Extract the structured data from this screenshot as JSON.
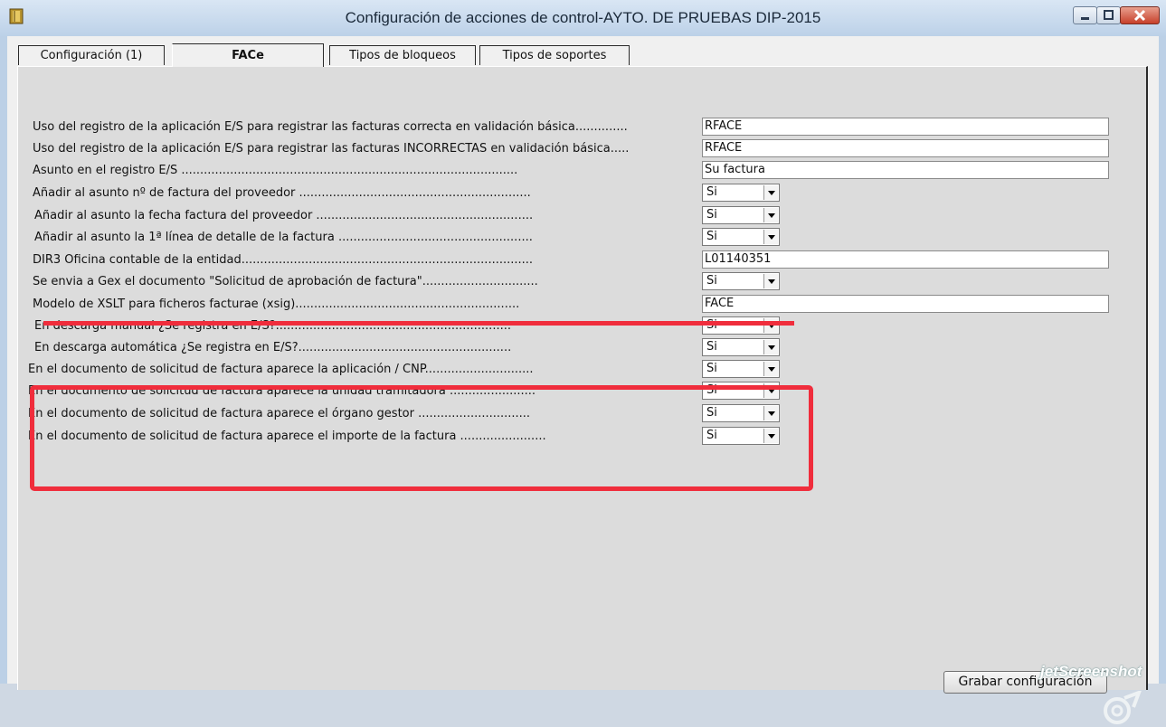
{
  "window": {
    "title": "Configuración de acciones de control-AYTO. DE PRUEBAS DIP-2015",
    "controls": [
      "minimize",
      "maximize",
      "close"
    ]
  },
  "tabs": [
    {
      "label": "Configuración (1)",
      "active": false
    },
    {
      "label": "FACe",
      "active": true
    },
    {
      "label": "Tipos de bloqueos",
      "active": false
    },
    {
      "label": "Tipos de soportes",
      "active": false
    }
  ],
  "settings": [
    {
      "label": "Uso del registro de la aplicación E/S para registrar las facturas correcta en validación básica..............",
      "kind": "text",
      "value": "RFACE"
    },
    {
      "label": "Uso del registro de la aplicación E/S para registrar las facturas INCORRECTAS en validación básica.....",
      "kind": "text",
      "value": "RFACE"
    },
    {
      "label": "Asunto en el registro E/S ..........................................................................................",
      "kind": "text",
      "value": "Su factura"
    },
    {
      "label": "Añadir al asunto nº de factura del proveedor ..............................................................",
      "kind": "select",
      "value": "Si"
    },
    {
      "label": " Añadir al asunto la fecha factura del proveedor ..........................................................",
      "kind": "select",
      "value": "Si"
    },
    {
      "label": " Añadir al asunto la 1ª línea de detalle de la factura ....................................................",
      "kind": "select",
      "value": "Si"
    },
    {
      "label": "DIR3 Oficina contable de la entidad..............................................................................",
      "kind": "text",
      "value": "L01140351"
    },
    {
      "label": "Se envia a Gex el documento \"Solicitud de aprobación de factura\"...............................",
      "kind": "select",
      "value": "Si"
    },
    {
      "label": "Modelo de XSLT para ficheros facturae (xsig)............................................................",
      "kind": "text",
      "value": "FACE"
    },
    {
      "label": " En descarga manual ¿Se registra en E/S?...............................................................",
      "kind": "select",
      "value": "Si"
    },
    {
      "label": " En descarga automática ¿Se registra en E/S?.........................................................",
      "kind": "select",
      "value": "Si"
    },
    {
      "label": "En el documento de solicitud de factura aparece la aplicación / CNP.............................",
      "kind": "select",
      "value": "Si"
    },
    {
      "label": "En el documento de solicitud de factura aparece la unidad tramitadora .......................",
      "kind": "select",
      "value": "Si"
    },
    {
      "label": "En el documento de solicitud de factura aparece el órgano gestor  ..............................",
      "kind": "select",
      "value": "Si"
    },
    {
      "label": "En el documento de solicitud de factura aparece el importe de la factura .......................",
      "kind": "select",
      "value": "Si"
    }
  ],
  "save_button": {
    "label": "Grabar configuración"
  },
  "watermark": {
    "text": "jetScreenshot"
  },
  "colors": {
    "highlight": "#f02d3c",
    "titlebar": "#bcd1e8",
    "panel": "#dcdcdc"
  }
}
